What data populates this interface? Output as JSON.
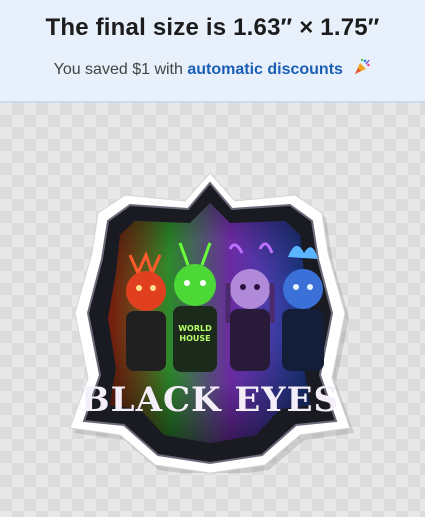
{
  "banner": {
    "title": "The final size is 1.63″ × 1.75″",
    "saved_prefix": "You saved $1 with ",
    "saved_link": "automatic discounts",
    "emoji": "party-popper-icon"
  },
  "sticker": {
    "title": "BLACK EYES",
    "hoodie_text_line1": "WORLD",
    "hoodie_text_line2": "HOUSE"
  }
}
